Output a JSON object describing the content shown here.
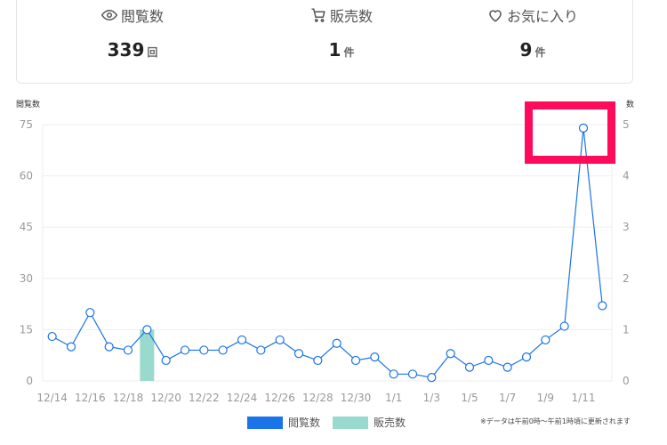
{
  "stats": {
    "views": {
      "label": "閲覧数",
      "value": "339",
      "unit": "回"
    },
    "sales": {
      "label": "販売数",
      "value": "1",
      "unit": "件"
    },
    "favorites": {
      "label": "お気に入り",
      "value": "9",
      "unit": "件"
    }
  },
  "chart_data": {
    "type": "bar",
    "categories": [
      "12/14",
      "12/15",
      "12/16",
      "12/17",
      "12/18",
      "12/19",
      "12/20",
      "12/21",
      "12/22",
      "12/23",
      "12/24",
      "12/25",
      "12/26",
      "12/27",
      "12/28",
      "12/29",
      "12/30",
      "12/31",
      "1/1",
      "1/2",
      "1/3",
      "1/4",
      "1/5",
      "1/6",
      "1/7",
      "1/8",
      "1/9",
      "1/10",
      "1/11",
      "1/12"
    ],
    "tick_labels": [
      "12/14",
      "12/16",
      "12/18",
      "12/20",
      "12/22",
      "12/24",
      "12/26",
      "12/28",
      "12/30",
      "1/1",
      "1/3",
      "1/5",
      "1/7",
      "1/9",
      "1/11"
    ],
    "left_axis_label": "閲覧数",
    "right_axis_label": "数",
    "left_ylim": [
      0,
      75
    ],
    "left_ticks": [
      0,
      15,
      30,
      45,
      60,
      75
    ],
    "right_ylim": [
      0,
      5
    ],
    "right_ticks": [
      0,
      1,
      2,
      3,
      4,
      5
    ],
    "series": [
      {
        "name": "閲覧数",
        "type": "line",
        "axis": "left",
        "color": "#1a73e8",
        "values": [
          13,
          10,
          20,
          10,
          9,
          15,
          6,
          9,
          9,
          9,
          12,
          9,
          12,
          8,
          6,
          11,
          6,
          7,
          2,
          2,
          1,
          8,
          4,
          6,
          4,
          7,
          12,
          16,
          74,
          22
        ]
      },
      {
        "name": "販売数",
        "type": "bar",
        "axis": "right",
        "color": "#98dace",
        "values": [
          0,
          0,
          0,
          0,
          0,
          1,
          0,
          0,
          0,
          0,
          0,
          0,
          0,
          0,
          0,
          0,
          0,
          0,
          0,
          0,
          0,
          0,
          0,
          0,
          0,
          0,
          0,
          0,
          0,
          0
        ]
      }
    ],
    "grid": true,
    "legend_position": "bottom-center"
  },
  "legend": {
    "views_label": "閲覧数",
    "views_color": "#1a73e8",
    "sales_label": "販売数",
    "sales_color": "#98dace"
  },
  "note": "※データは午前0時〜午前1時頃に更新されます"
}
